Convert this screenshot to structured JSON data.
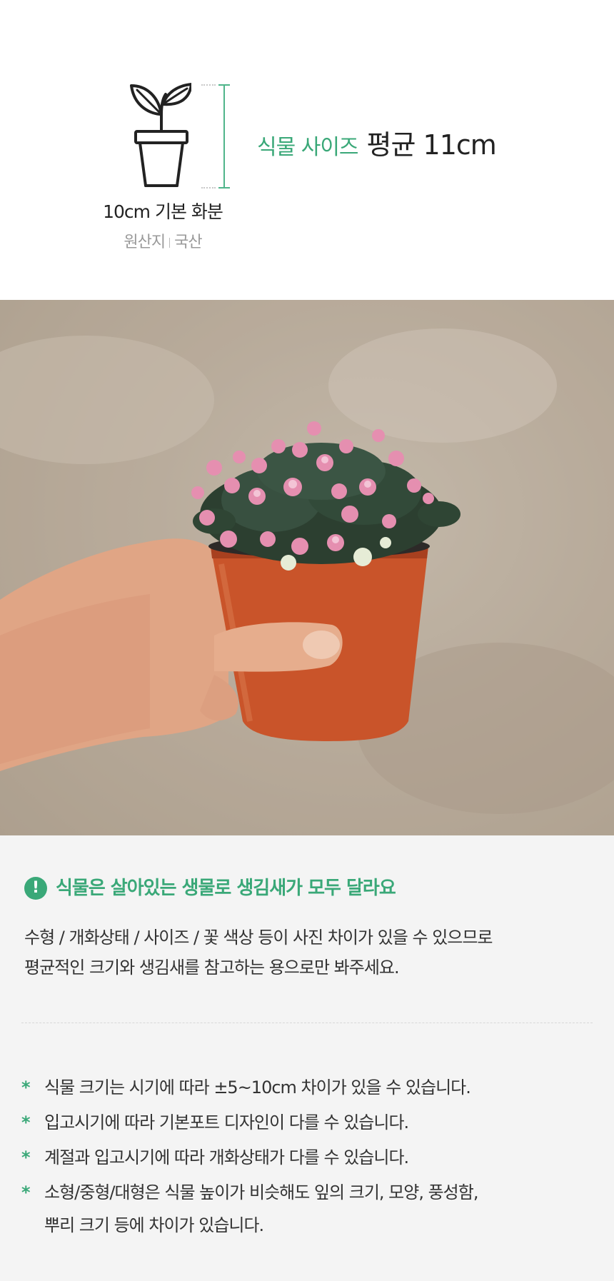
{
  "size_info": {
    "label": "식물 사이즈",
    "value": "평균 11cm",
    "pot_name": "10cm 기본 화분",
    "origin_label": "원산지",
    "origin_value": "국산",
    "pot_icon": "sprout-pot-icon"
  },
  "photo": {
    "description_icon": "plant-photo"
  },
  "notice": {
    "icon": "exclamation-icon",
    "heading": "식물은 살아있는 생물로 생김새가 모두 달라요",
    "body_line1": "수형 / 개화상태 / 사이즈 / 꽃 색상 등이 사진 차이가 있을 수 있으므로",
    "body_line2": "평균적인 크기와 생김새를 참고하는 용으로만 봐주세요.",
    "bullets": [
      "식물 크기는 시기에 따라 ±5~10cm 차이가 있을 수 있습니다.",
      "입고시기에 따라 기본포트 디자인이 다를 수 있습니다.",
      "계절과 입고시기에 따라 개화상태가 다를 수 있습니다.",
      "소형/중형/대형은 식물 높이가 비슷해도 잎의 크기, 모양,  풍성함,",
      "뿌리 크기 등에 차이가 있습니다."
    ],
    "bullet_marker": "*",
    "accent_color": "#3aa878"
  }
}
